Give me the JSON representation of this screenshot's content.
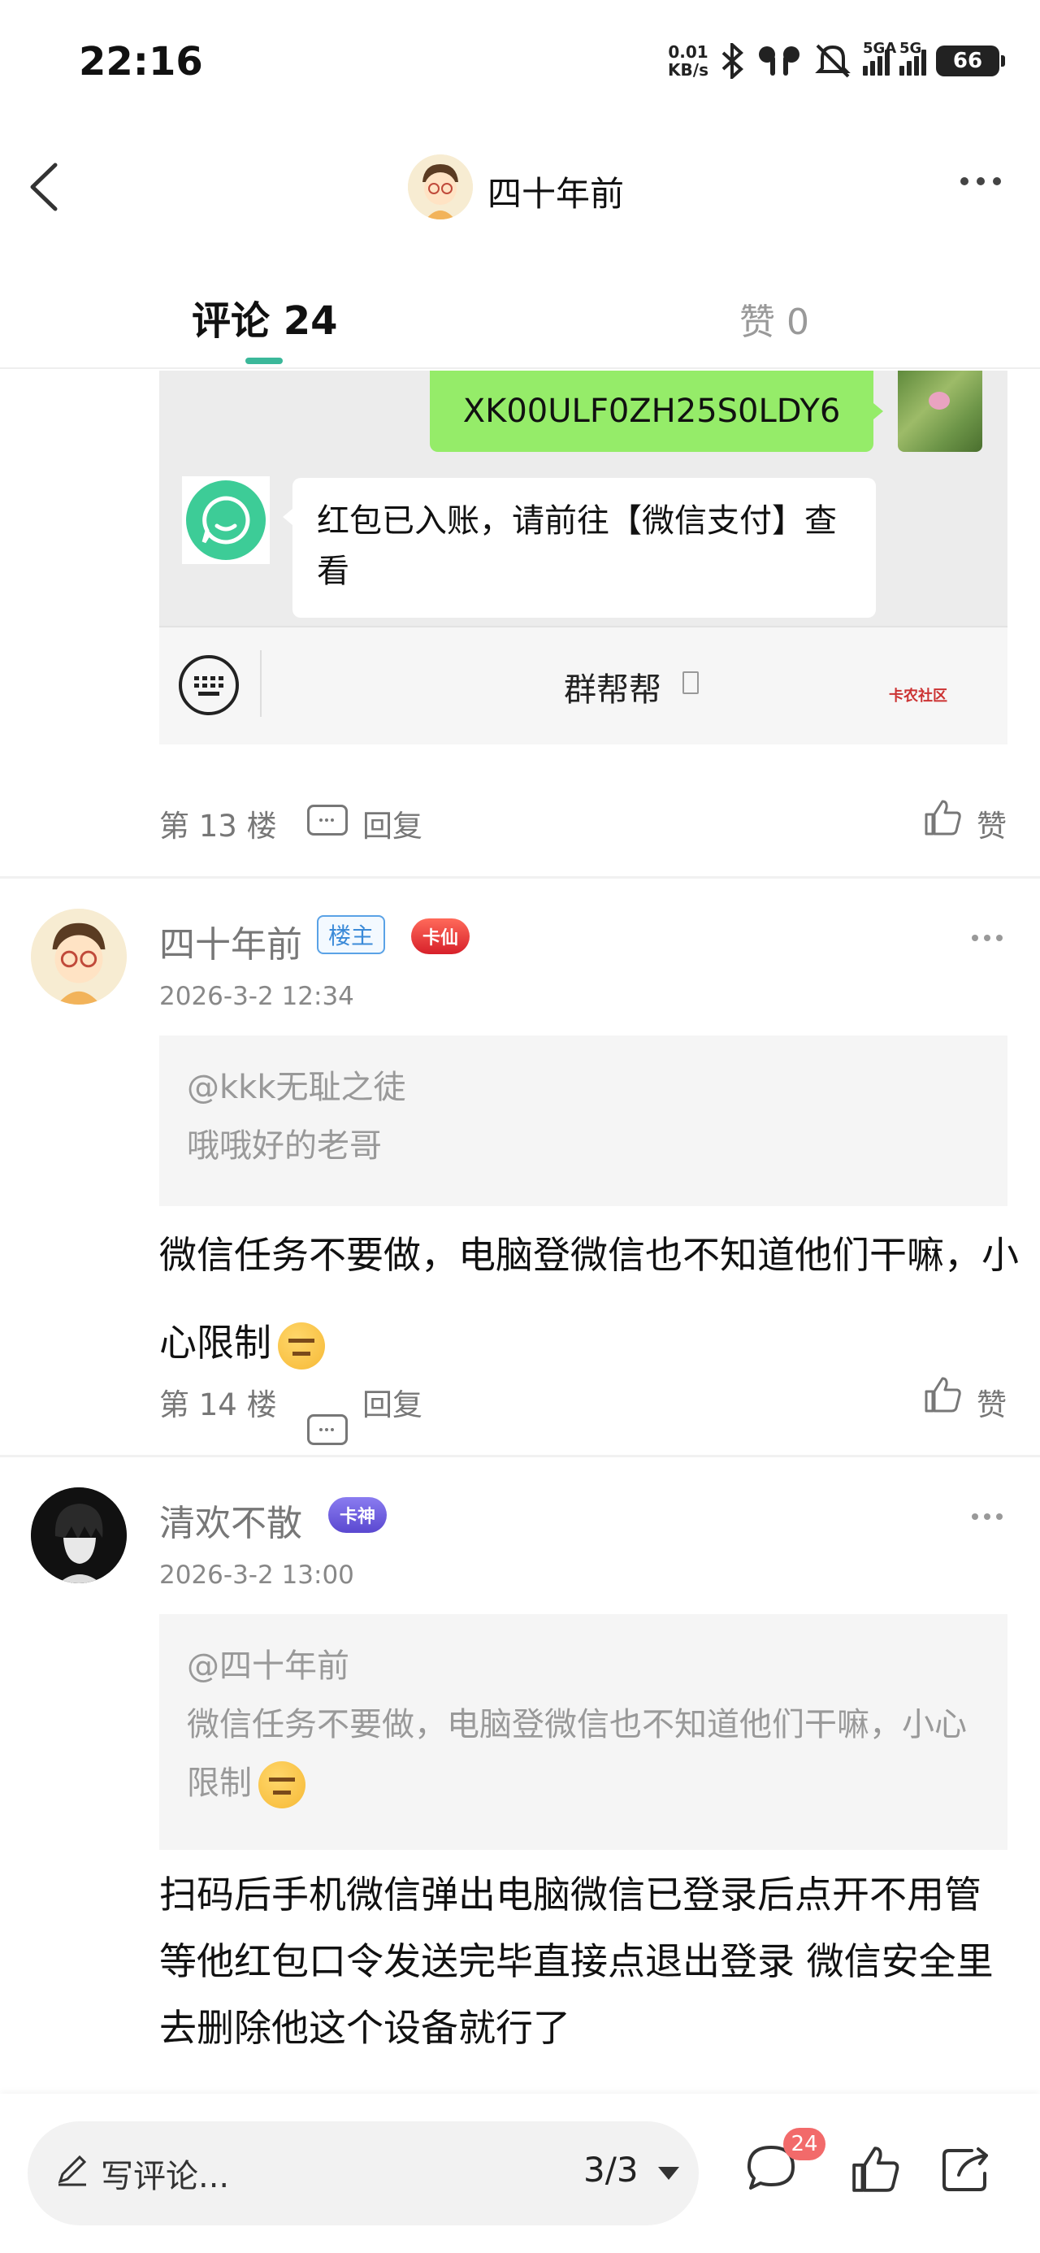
{
  "status_bar": {
    "time": "22:16",
    "net_speed_value": "0.01",
    "net_speed_unit": "KB/s",
    "sim1_label": "5GA",
    "sim2_label": "5G",
    "battery": "66"
  },
  "header": {
    "title": "四十年前",
    "tab_comments": "评论 24",
    "tab_likes": "赞 0"
  },
  "screenshot_image": {
    "sent_code": "XK00ULF0ZH25S0LDY6",
    "bot_message": "红包已入账，请前往【微信支付】查看",
    "group_name": "群帮帮",
    "watermark": "卡农社区"
  },
  "floor13": {
    "floor": "第 13 楼",
    "reply": "回复",
    "like": "赞"
  },
  "comment14": {
    "username": "四十年前",
    "host_badge": "楼主",
    "rank_badge": "卡仙",
    "date": "2026-3-2 12:34",
    "quote_user": "@kkk无耻之徒",
    "quote_text": "哦哦好的老哥",
    "body": "微信任务不要做，电脑登微信也不知道他们干嘛，小心限制",
    "floor": "第 14 楼",
    "reply": "回复",
    "like": "赞"
  },
  "comment15": {
    "username": "清欢不散",
    "rank_badge": "卡神",
    "date": "2026-3-2 13:00",
    "quote_user": "@四十年前",
    "quote_text": "微信任务不要做，电脑登微信也不知道他们干嘛，小心限制",
    "body": "扫码后手机微信弹出电脑微信已登录后点开不用管 等他红包口令发送完毕直接点退出登录  微信安全里去删除他这个设备就行了"
  },
  "bottom_bar": {
    "placeholder": "写评论...",
    "page": "3/3",
    "comment_count": "24"
  },
  "colors": {
    "accent": "#3bb89a",
    "wechat_green": "#95ec69",
    "badge_red": "#f26a6a"
  }
}
